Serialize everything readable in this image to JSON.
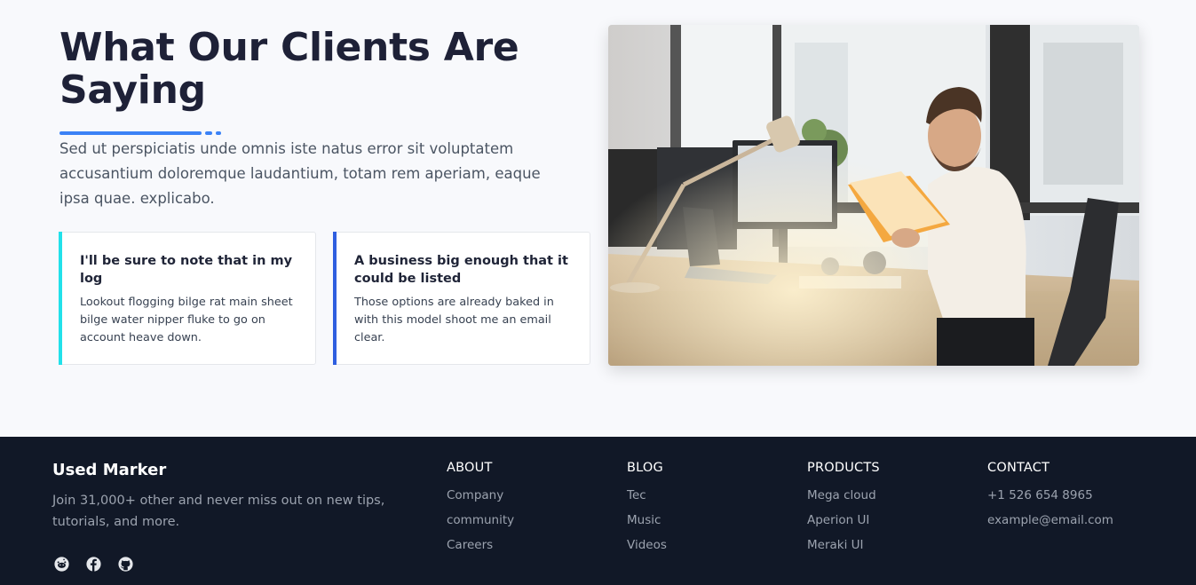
{
  "testimonials": {
    "heading": "What Our Clients Are Saying",
    "intro": "Sed ut perspiciatis unde omnis iste natus error sit voluptatem accusantium doloremque laudantium, totam rem aperiam, eaque ipsa quae. explicabo.",
    "accent_color": "#3b82f6",
    "cards": [
      {
        "title": "I'll be sure to note that in my log",
        "text": "Lookout flogging bilge rat main sheet bilge water nipper fluke to go on account heave down.",
        "bar_color": "#22e1ea"
      },
      {
        "title": "A business big enough that it could be listed",
        "text": "Those options are already baked in with this model shoot me an email clear.",
        "bar_color": "#2f5fe0"
      }
    ],
    "photo": "man-at-desk-reading-book"
  },
  "footer": {
    "brand": "Used Marker",
    "tagline": "Join 31,000+ other and never miss out on new tips, tutorials, and more.",
    "social_icons": [
      "reddit-icon",
      "facebook-icon",
      "github-icon"
    ],
    "columns": [
      {
        "title": "ABOUT",
        "links": [
          "Company",
          "community",
          "Careers"
        ]
      },
      {
        "title": "BLOG",
        "links": [
          "Tec",
          "Music",
          "Videos"
        ]
      },
      {
        "title": "PRODUCTS",
        "links": [
          "Mega cloud",
          "Aperion UI",
          "Meraki UI"
        ]
      },
      {
        "title": "CONTACT",
        "links": [
          "+1 526 654 8965",
          "example@email.com"
        ]
      }
    ]
  }
}
